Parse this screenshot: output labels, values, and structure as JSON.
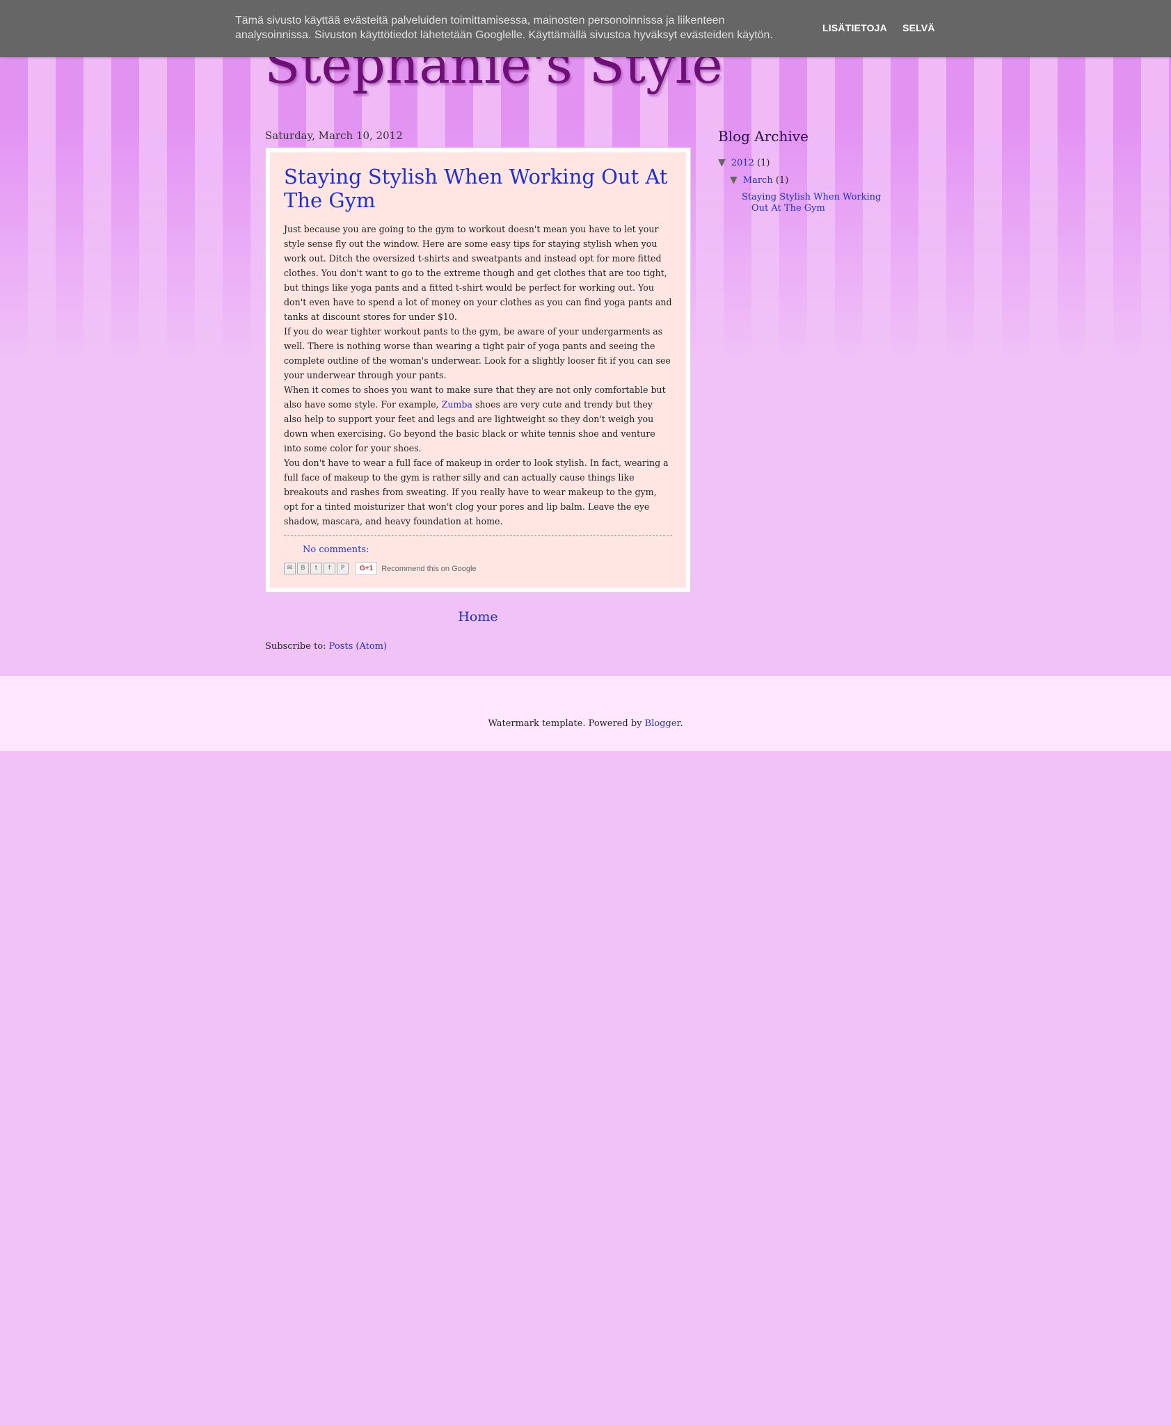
{
  "cookie_banner": {
    "text_line1": "Tämä sivusto käyttää evästeitä palveluiden toimittamisessa, mainosten personoinnissa ja liikenteen",
    "text_line2": "analysoinnissa. Sivuston käyttötiedot lähetetään Googlelle. Käyttämällä sivustoa hyväksyt evästeiden käytön.",
    "learn_more": "LISÄTIETOJA",
    "ok": "SELVÄ"
  },
  "header": {
    "title": "Stephanie's Style"
  },
  "post": {
    "date": "Saturday, March 10, 2012",
    "title": "Staying Stylish When Working Out At The Gym",
    "p1": "Just because you are going to the gym to workout doesn't mean you have to let your style sense fly out the window. Here are some easy tips for staying stylish when you work out. Ditch the oversized t-shirts and sweatpants and instead opt for more fitted clothes. You don't want to go to the extreme though and get clothes that are too tight, but things like yoga pants and a fitted t-shirt would be perfect for working out. You don't even have to spend a lot of money on your clothes as you can find yoga pants and tanks at discount stores for under $10.",
    "p2": "If you do wear tighter workout pants to the gym, be aware of your undergarments as well. There is nothing worse than wearing a tight pair of yoga pants and seeing the complete outline of the woman's underwear. Look for a slightly looser fit if you can see your underwear through your pants.",
    "p3_before": "When it comes to shoes you want to make sure that they are not only comfortable but also have some style. For example, ",
    "p3_link": "Zumba",
    "p3_after": " shoes are very cute and trendy but they also help to support your feet and legs and are lightweight so they don't weigh you down when exercising. Go beyond the basic black or white tennis shoe and venture into some color for your shoes.",
    "p4": "You don't have to wear a full face of makeup in order to look stylish. In fact, wearing a full face of makeup to the gym is rather silly and can actually cause things like breakouts and rashes from sweating. If you really have to wear makeup to the gym, opt for a tinted moisturizer that won't clog your pores and lip balm. Leave the eye shadow, mascara, and heavy foundation at home.",
    "comments": "No comments:",
    "share_icons": [
      "email-icon",
      "blogger-icon",
      "twitter-icon",
      "facebook-icon",
      "pinterest-icon"
    ],
    "gplus_label": "G+1",
    "recommend": "Recommend this on Google"
  },
  "nav": {
    "home": "Home",
    "subscribe_label": "Subscribe to: ",
    "subscribe_link": "Posts (Atom)"
  },
  "sidebar": {
    "heading": "Blog Archive",
    "year": "2012",
    "year_count": "(1)",
    "month": "March",
    "month_count": "(1)",
    "post_link": "Staying Stylish When Working Out At The Gym"
  },
  "footer": {
    "text": "Watermark template. Powered by ",
    "link": "Blogger",
    "period": "."
  },
  "colors": {
    "background": "#f1c2f8",
    "title": "#6f0f78",
    "link": "#1f2fd0",
    "post_bg": "#ffe6e3",
    "cookie_bar": "#666666"
  }
}
